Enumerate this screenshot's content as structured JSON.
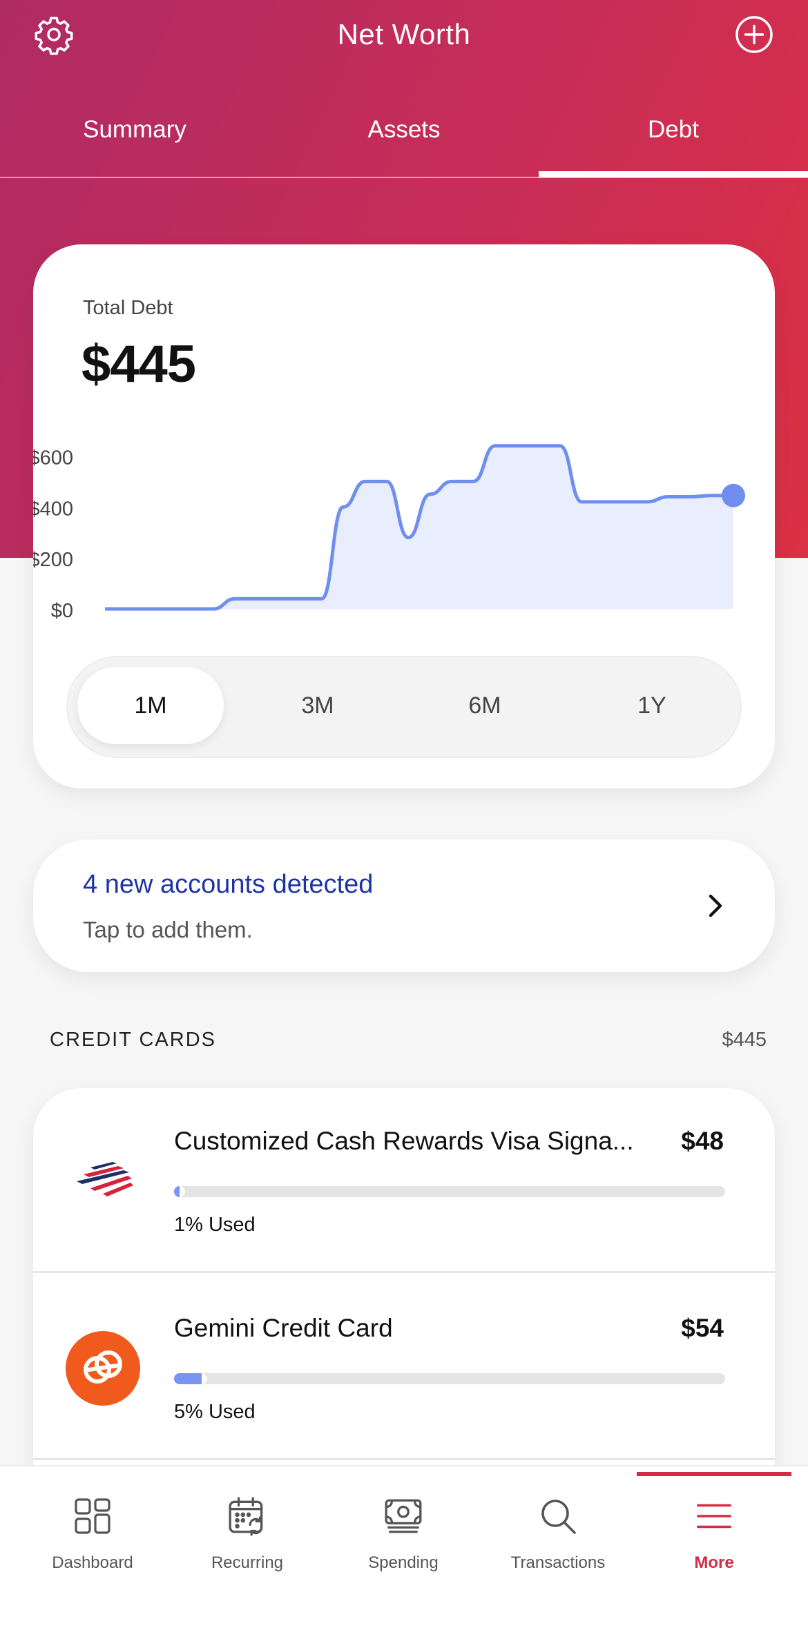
{
  "header": {
    "title": "Net Worth",
    "settings_icon": "gear-icon",
    "add_icon": "plus-circle-icon"
  },
  "tabs": [
    {
      "label": "Summary",
      "active": false
    },
    {
      "label": "Assets",
      "active": false
    },
    {
      "label": "Debt",
      "active": true
    }
  ],
  "total": {
    "label": "Total Debt",
    "value": "$445"
  },
  "chart_data": {
    "type": "area",
    "ylim": [
      0,
      650
    ],
    "yticks": [
      "$600",
      "$400",
      "$200",
      "$0"
    ],
    "ytick_values": [
      600,
      400,
      200,
      0
    ],
    "x": [
      0,
      1,
      2,
      3,
      4,
      5,
      6,
      7,
      8,
      9,
      10,
      11,
      12,
      13,
      14,
      15,
      16,
      17,
      18,
      19,
      20,
      21,
      22,
      23,
      24,
      25,
      26,
      27,
      28,
      29
    ],
    "values": [
      0,
      0,
      0,
      0,
      0,
      0,
      40,
      40,
      40,
      40,
      40,
      400,
      500,
      500,
      280,
      450,
      500,
      500,
      640,
      640,
      640,
      640,
      420,
      420,
      420,
      420,
      440,
      440,
      445,
      445
    ],
    "line_color": "#6f8ef0",
    "fill_color": "#e8eefd",
    "last_point_highlighted": true
  },
  "ranges": [
    {
      "label": "1M",
      "active": true
    },
    {
      "label": "3M",
      "active": false
    },
    {
      "label": "6M",
      "active": false
    },
    {
      "label": "1Y",
      "active": false
    }
  ],
  "detected": {
    "title": "4 new accounts detected",
    "subtitle": "Tap to add them.",
    "icon": "chevron-right-icon"
  },
  "credit_cards": {
    "heading": "CREDIT CARDS",
    "total": "$445",
    "accounts": [
      {
        "name": "Customized Cash Rewards Visa Signa...",
        "amount": "$48",
        "used_label": "1% Used",
        "used_fraction": 0.01,
        "logo": "bank-of-america-logo"
      },
      {
        "name": "Gemini Credit Card",
        "amount": "$54",
        "used_label": "5% Used",
        "used_fraction": 0.05,
        "logo": "gemini-logo"
      }
    ]
  },
  "bottom_nav": [
    {
      "label": "Dashboard",
      "icon": "dashboard-icon",
      "active": false
    },
    {
      "label": "Recurring",
      "icon": "calendar-recurring-icon",
      "active": false
    },
    {
      "label": "Spending",
      "icon": "cash-icon",
      "active": false
    },
    {
      "label": "Transactions",
      "icon": "search-icon",
      "active": false
    },
    {
      "label": "More",
      "icon": "menu-icon",
      "active": true
    }
  ],
  "colors": {
    "brand_gradient_start": "#b02b63",
    "brand_gradient_end": "#dc3043",
    "link_blue": "#1e34a6",
    "accent_red": "#d22d46",
    "progress_blue": "#7b93f1"
  }
}
